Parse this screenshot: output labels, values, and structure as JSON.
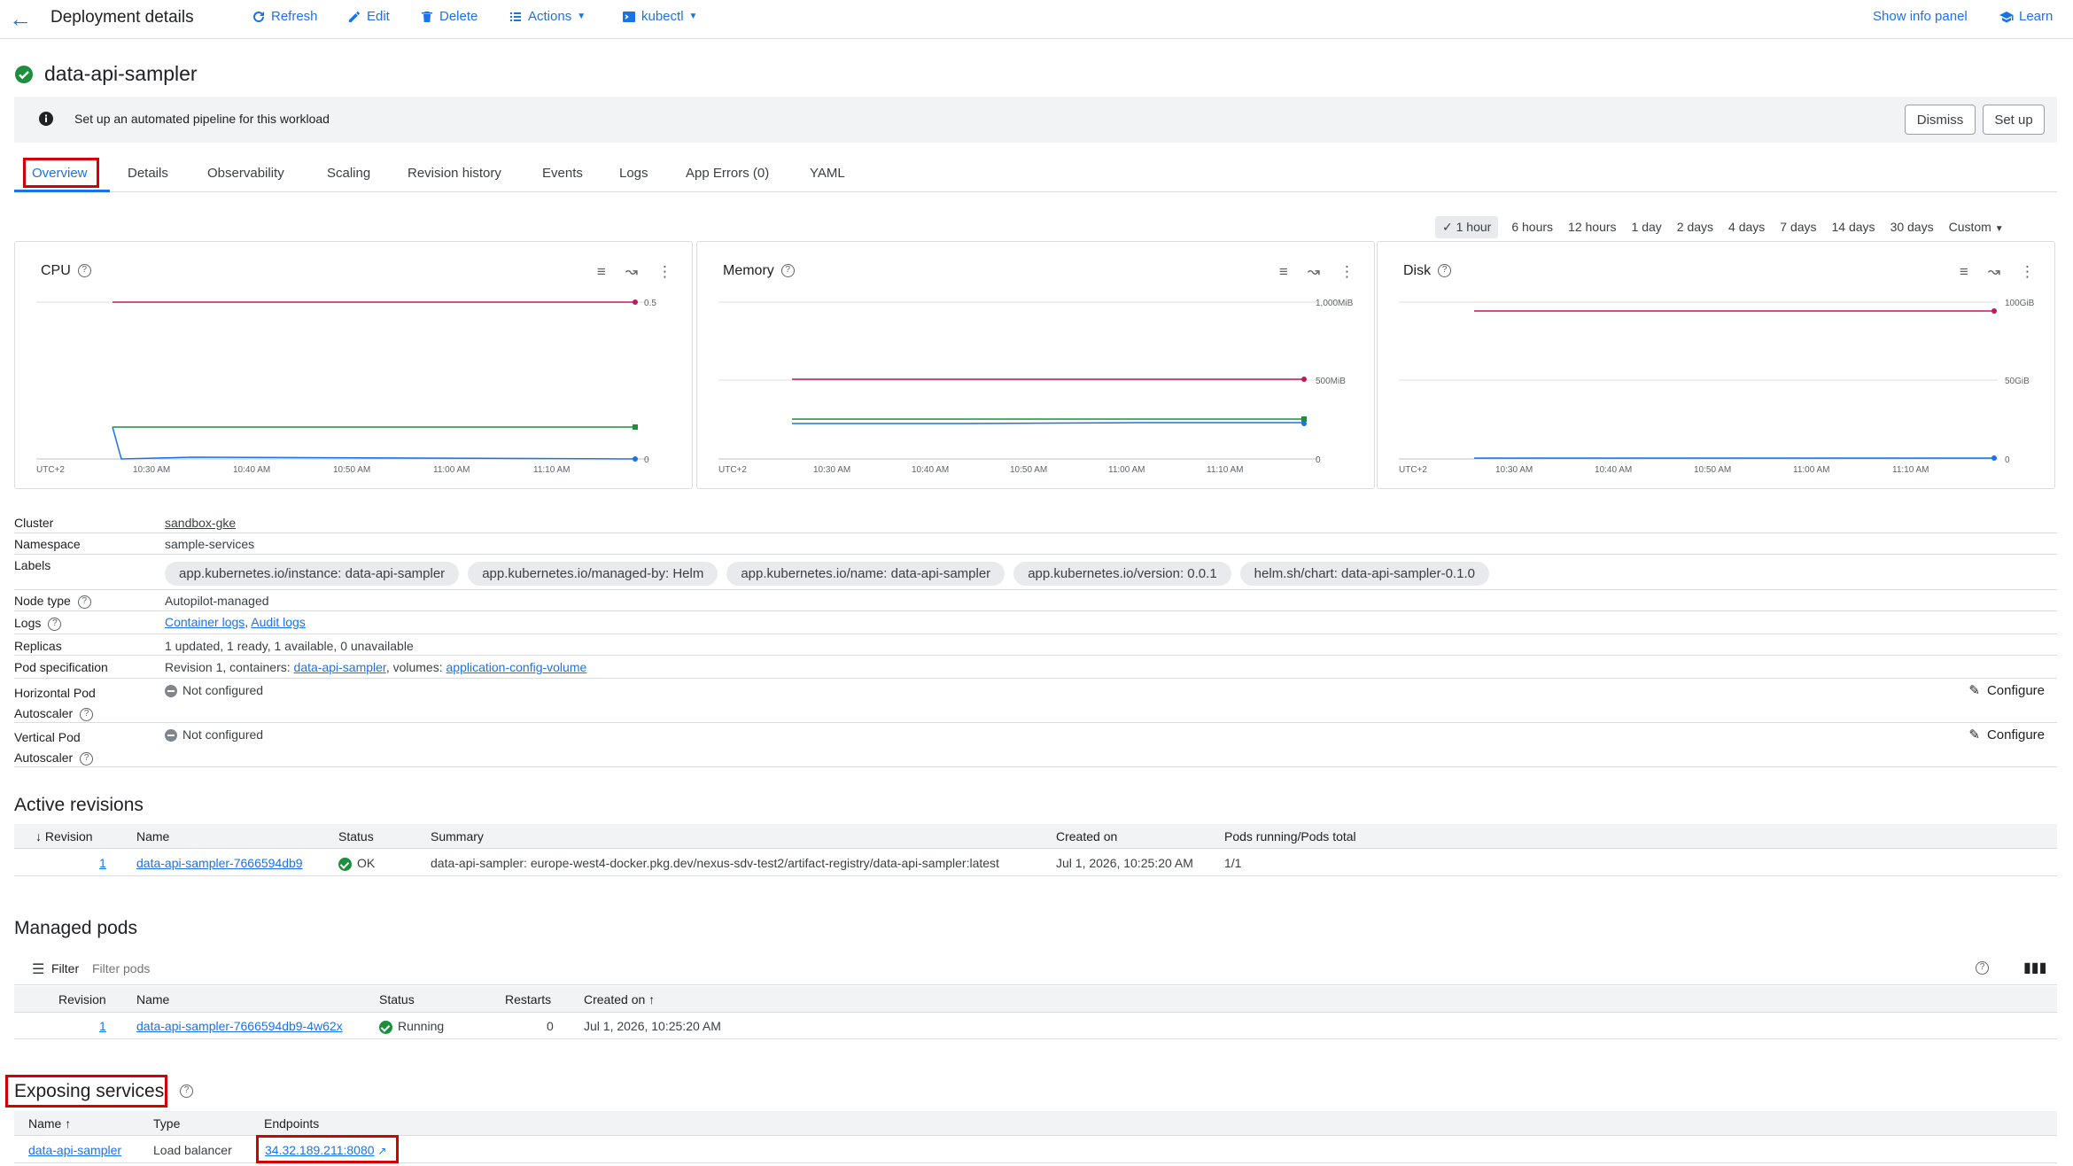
{
  "header": {
    "title": "Deployment details",
    "refresh": "Refresh",
    "edit": "Edit",
    "delete": "Delete",
    "actions": "Actions",
    "kubectl": "kubectl",
    "show_info_panel": "Show info panel",
    "learn": "Learn"
  },
  "workload": {
    "name": "data-api-sampler"
  },
  "banner": {
    "text": "Set up an automated pipeline for this workload",
    "dismiss": "Dismiss",
    "setup": "Set up"
  },
  "tabs": [
    "Overview",
    "Details",
    "Observability",
    "Scaling",
    "Revision history",
    "Events",
    "Logs",
    "App Errors (0)",
    "YAML"
  ],
  "time_range": {
    "selected": "1 hour",
    "options": [
      "6 hours",
      "12 hours",
      "1 day",
      "2 days",
      "4 days",
      "7 days",
      "14 days",
      "30 days"
    ],
    "custom": "Custom"
  },
  "charts": [
    {
      "title": "CPU",
      "ymax_label": "0.5",
      "ymid_label": "",
      "yzero_label": "0",
      "timezone": "UTC+2",
      "xticks": [
        "10:30 AM",
        "10:40 AM",
        "10:50 AM",
        "11:00 AM",
        "11:10 AM"
      ]
    },
    {
      "title": "Memory",
      "ymax_label": "1,000MiB",
      "ymid_label": "500MiB",
      "yzero_label": "0",
      "timezone": "UTC+2",
      "xticks": [
        "10:30 AM",
        "10:40 AM",
        "10:50 AM",
        "11:00 AM",
        "11:10 AM"
      ]
    },
    {
      "title": "Disk",
      "ymax_label": "100GiB",
      "ymid_label": "50GiB",
      "yzero_label": "0",
      "timezone": "UTC+2",
      "xticks": [
        "10:30 AM",
        "10:40 AM",
        "10:50 AM",
        "11:00 AM",
        "11:10 AM"
      ]
    }
  ],
  "chart_colors": {
    "limit": "#c2185b",
    "request": "#1e8e3e",
    "usage": "#1a73e8"
  },
  "details": {
    "cluster_label": "Cluster",
    "cluster": "sandbox-gke",
    "namespace_label": "Namespace",
    "namespace": "sample-services",
    "labels_label": "Labels",
    "labels": [
      "app.kubernetes.io/instance: data-api-sampler",
      "app.kubernetes.io/managed-by: Helm",
      "app.kubernetes.io/name: data-api-sampler",
      "app.kubernetes.io/version: 0.0.1",
      "helm.sh/chart: data-api-sampler-0.1.0"
    ],
    "node_type_label": "Node type",
    "node_type": "Autopilot-managed",
    "logs_label": "Logs",
    "container_logs": "Container logs",
    "audit_logs": "Audit logs",
    "logs_sep": ",",
    "replicas_label": "Replicas",
    "replicas": "1 updated, 1 ready, 1 available, 0 unavailable",
    "pod_spec_label": "Pod specification",
    "pod_spec_prefix": "Revision 1, containers:",
    "pod_spec_container": "data-api-sampler",
    "pod_spec_mid": ", volumes:",
    "pod_spec_volume": "application-config-volume",
    "hpa_label_1": "Horizontal Pod",
    "hpa_label_2": "Autoscaler",
    "hpa_value": "Not configured",
    "vpa_label_1": "Vertical Pod",
    "vpa_label_2": "Autoscaler",
    "vpa_value": "Not configured",
    "configure": "Configure"
  },
  "active_revisions": {
    "title": "Active revisions",
    "columns": [
      "Revision",
      "Name",
      "Status",
      "Summary",
      "Created on",
      "Pods running/Pods total"
    ],
    "rows": [
      {
        "revision": "1",
        "name": "data-api-sampler-7666594db9",
        "status": "OK",
        "summary": "data-api-sampler: europe-west4-docker.pkg.dev/nexus-sdv-test2/artifact-registry/data-api-sampler:latest",
        "created": "Jul 1, 2026, 10:25:20 AM",
        "pods": "1/1"
      }
    ]
  },
  "managed_pods": {
    "title": "Managed pods",
    "filter_label": "Filter",
    "filter_placeholder": "Filter pods",
    "columns": [
      "Revision",
      "Name",
      "Status",
      "Restarts",
      "Created on"
    ],
    "rows": [
      {
        "revision": "1",
        "name": "data-api-sampler-7666594db9-4w62x",
        "status": "Running",
        "restarts": "0",
        "created": "Jul 1, 2026, 10:25:20 AM"
      }
    ]
  },
  "exposing_services": {
    "title": "Exposing services",
    "columns": [
      "Name",
      "Type",
      "Endpoints"
    ],
    "rows": [
      {
        "name": "data-api-sampler",
        "type": "Load balancer",
        "endpoint": "34.32.189.211:8080"
      }
    ]
  }
}
